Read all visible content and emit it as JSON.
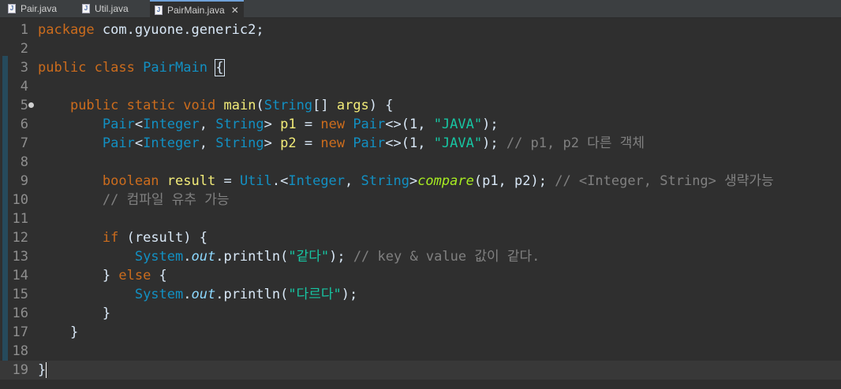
{
  "tabs": [
    {
      "label": "Pair.java",
      "active": false
    },
    {
      "label": "Util.java",
      "active": false
    },
    {
      "label": "PairMain.java",
      "active": true
    }
  ],
  "colors": {
    "keyword": "#cc6c1d",
    "class": "#1290c3",
    "variable": "#f3ec79",
    "string": "#17c6a3",
    "comment": "#808080",
    "method": "#a7ec21",
    "static_field": "#8dd9ff",
    "text": "#d9e8f7"
  },
  "lines": [
    {
      "num": "1",
      "tokens": [
        [
          "kw",
          "package"
        ],
        [
          "t",
          " com.gyuone.generic2;"
        ]
      ]
    },
    {
      "num": "2",
      "tokens": []
    },
    {
      "num": "3",
      "tokens": [
        [
          "kw",
          "public"
        ],
        [
          "t",
          " "
        ],
        [
          "kw",
          "class"
        ],
        [
          "t",
          " "
        ],
        [
          "cls",
          "PairMain"
        ],
        [
          "t",
          " "
        ],
        [
          "box",
          "{"
        ]
      ]
    },
    {
      "num": "4",
      "tokens": []
    },
    {
      "num": "5",
      "tokens": [
        [
          "t",
          "    "
        ],
        [
          "kw",
          "public"
        ],
        [
          "t",
          " "
        ],
        [
          "kw",
          "static"
        ],
        [
          "t",
          " "
        ],
        [
          "kw",
          "void"
        ],
        [
          "t",
          " "
        ],
        [
          "var",
          "main"
        ],
        [
          "t",
          "("
        ],
        [
          "cls",
          "String"
        ],
        [
          "t",
          "[] "
        ],
        [
          "var",
          "args"
        ],
        [
          "t",
          ") {"
        ]
      ]
    },
    {
      "num": "6",
      "tokens": [
        [
          "t",
          "        "
        ],
        [
          "cls",
          "Pair"
        ],
        [
          "t",
          "<"
        ],
        [
          "cls",
          "Integer"
        ],
        [
          "t",
          ", "
        ],
        [
          "cls",
          "String"
        ],
        [
          "t",
          "> "
        ],
        [
          "var",
          "p1"
        ],
        [
          "t",
          " = "
        ],
        [
          "kw",
          "new"
        ],
        [
          "t",
          " "
        ],
        [
          "cls",
          "Pair"
        ],
        [
          "t",
          "<>(1, "
        ],
        [
          "str",
          "\"JAVA\""
        ],
        [
          "t",
          ");"
        ]
      ]
    },
    {
      "num": "7",
      "tokens": [
        [
          "t",
          "        "
        ],
        [
          "cls",
          "Pair"
        ],
        [
          "t",
          "<"
        ],
        [
          "cls",
          "Integer"
        ],
        [
          "t",
          ", "
        ],
        [
          "cls",
          "String"
        ],
        [
          "t",
          "> "
        ],
        [
          "var",
          "p2"
        ],
        [
          "t",
          " = "
        ],
        [
          "kw",
          "new"
        ],
        [
          "t",
          " "
        ],
        [
          "cls",
          "Pair"
        ],
        [
          "t",
          "<>(1, "
        ],
        [
          "str",
          "\"JAVA\""
        ],
        [
          "t",
          "); "
        ],
        [
          "com",
          "// p1, p2 다른 객체"
        ]
      ]
    },
    {
      "num": "8",
      "tokens": []
    },
    {
      "num": "9",
      "tokens": [
        [
          "t",
          "        "
        ],
        [
          "kw",
          "boolean"
        ],
        [
          "t",
          " "
        ],
        [
          "var",
          "result"
        ],
        [
          "t",
          " = "
        ],
        [
          "cls",
          "Util"
        ],
        [
          "t",
          ".<"
        ],
        [
          "cls",
          "Integer"
        ],
        [
          "t",
          ", "
        ],
        [
          "cls",
          "String"
        ],
        [
          "t",
          ">"
        ],
        [
          "meth",
          "compare"
        ],
        [
          "t",
          "(p1, p2); "
        ],
        [
          "com",
          "// <Integer, String> 생략가능"
        ]
      ]
    },
    {
      "num": "10",
      "tokens": [
        [
          "t",
          "        "
        ],
        [
          "com",
          "// 컴파일 유추 가능"
        ]
      ]
    },
    {
      "num": "11",
      "tokens": []
    },
    {
      "num": "12",
      "tokens": [
        [
          "t",
          "        "
        ],
        [
          "kw",
          "if"
        ],
        [
          "t",
          " (result) {"
        ]
      ]
    },
    {
      "num": "13",
      "tokens": [
        [
          "t",
          "            "
        ],
        [
          "cls",
          "System"
        ],
        [
          "t",
          "."
        ],
        [
          "fld",
          "out"
        ],
        [
          "t",
          ".println("
        ],
        [
          "str",
          "\"같다\""
        ],
        [
          "t",
          "); "
        ],
        [
          "com",
          "// key & value 값이 같다."
        ]
      ]
    },
    {
      "num": "14",
      "tokens": [
        [
          "t",
          "        } "
        ],
        [
          "kw",
          "else"
        ],
        [
          "t",
          " {"
        ]
      ]
    },
    {
      "num": "15",
      "tokens": [
        [
          "t",
          "            "
        ],
        [
          "cls",
          "System"
        ],
        [
          "t",
          "."
        ],
        [
          "fld",
          "out"
        ],
        [
          "t",
          ".println("
        ],
        [
          "str",
          "\"다르다\""
        ],
        [
          "t",
          ");"
        ]
      ]
    },
    {
      "num": "16",
      "tokens": [
        [
          "t",
          "        }"
        ]
      ]
    },
    {
      "num": "17",
      "tokens": [
        [
          "t",
          "    }"
        ]
      ]
    },
    {
      "num": "18",
      "tokens": []
    },
    {
      "num": "19",
      "tokens": [
        [
          "t",
          "}"
        ]
      ]
    }
  ]
}
